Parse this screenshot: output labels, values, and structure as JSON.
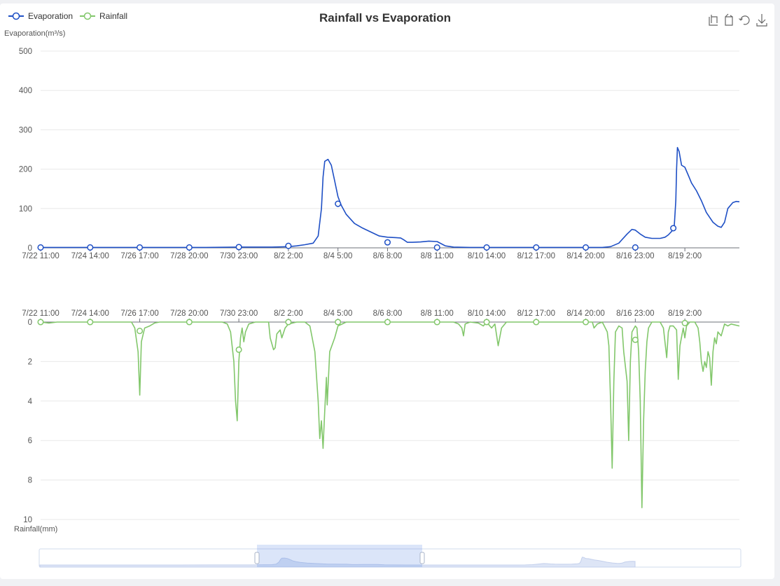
{
  "chart_data": {
    "type": "line",
    "title": "Rainfall vs Evaporation",
    "legend": {
      "placement": "top-left",
      "entries": [
        "Evaporation",
        "Rainfall"
      ]
    },
    "toolbox_icons": [
      "zoom-icon",
      "zoom-reset-icon",
      "restore-icon",
      "download-icon"
    ],
    "colors": {
      "Evaporation": "#1e4fc5",
      "Rainfall": "#82c76b"
    },
    "x_tick_labels": [
      "7/22 11:00",
      "7/24 14:00",
      "7/26 17:00",
      "7/28 20:00",
      "7/30 23:00",
      "8/2 2:00",
      "8/4 5:00",
      "8/6 8:00",
      "8/8 11:00",
      "8/10 14:00",
      "8/12 17:00",
      "8/14 20:00",
      "8/16 23:00",
      "8/19 2:00"
    ],
    "top": {
      "ylabel": "Evaporation(m³/s)",
      "ylim": [
        0,
        500
      ],
      "yticks": [
        0,
        100,
        200,
        300,
        400,
        500
      ],
      "series": [
        {
          "name": "Evaporation",
          "points": [
            [
              0,
              1
            ],
            [
              2,
              1
            ],
            [
              4,
              1
            ],
            [
              6,
              1
            ],
            [
              8,
              1
            ],
            [
              10,
              1
            ],
            [
              12,
              2
            ],
            [
              14,
              2
            ],
            [
              15,
              3
            ],
            [
              15.5,
              5
            ],
            [
              16,
              8
            ],
            [
              16.5,
              12
            ],
            [
              16.8,
              30
            ],
            [
              17,
              100
            ],
            [
              17.1,
              180
            ],
            [
              17.2,
              220
            ],
            [
              17.4,
              225
            ],
            [
              17.6,
              210
            ],
            [
              17.8,
              170
            ],
            [
              18,
              130
            ],
            [
              18.2,
              108
            ],
            [
              18.5,
              85
            ],
            [
              19,
              62
            ],
            [
              19.5,
              50
            ],
            [
              20,
              40
            ],
            [
              20.5,
              30
            ],
            [
              21,
              27
            ],
            [
              21.5,
              26
            ],
            [
              21.8,
              25
            ],
            [
              22,
              20
            ],
            [
              22.2,
              14
            ],
            [
              22.5,
              14
            ],
            [
              23,
              15
            ],
            [
              23.5,
              17
            ],
            [
              24,
              16
            ],
            [
              24.5,
              5
            ],
            [
              25,
              2
            ],
            [
              26,
              1
            ],
            [
              28,
              1
            ],
            [
              30,
              1
            ],
            [
              32,
              1
            ],
            [
              34,
              1
            ],
            [
              34.5,
              3
            ],
            [
              35,
              12
            ],
            [
              35.5,
              35
            ],
            [
              35.8,
              47
            ],
            [
              36,
              45
            ],
            [
              36.3,
              35
            ],
            [
              36.6,
              27
            ],
            [
              37,
              24
            ],
            [
              37.5,
              24
            ],
            [
              37.8,
              27
            ],
            [
              38,
              33
            ],
            [
              38.2,
              42
            ],
            [
              38.35,
              50
            ],
            [
              38.45,
              120
            ],
            [
              38.5,
              200
            ],
            [
              38.55,
              255
            ],
            [
              38.65,
              245
            ],
            [
              38.8,
              210
            ],
            [
              39,
              205
            ],
            [
              39.2,
              185
            ],
            [
              39.4,
              165
            ],
            [
              39.7,
              145
            ],
            [
              40,
              120
            ],
            [
              40.3,
              90
            ],
            [
              40.7,
              65
            ],
            [
              41,
              55
            ],
            [
              41.2,
              52
            ],
            [
              41.4,
              65
            ],
            [
              41.6,
              100
            ],
            [
              41.9,
              115
            ],
            [
              42.1,
              118
            ],
            [
              42.3,
              117
            ]
          ],
          "markers": [
            [
              0,
              1
            ],
            [
              3,
              1
            ],
            [
              6,
              1
            ],
            [
              9,
              1
            ],
            [
              12,
              2
            ],
            [
              15,
              5
            ],
            [
              18,
              112
            ],
            [
              21,
              14
            ],
            [
              24,
              1
            ],
            [
              27,
              1
            ],
            [
              30,
              1
            ],
            [
              33,
              1
            ],
            [
              36,
              1
            ],
            [
              38.3,
              50
            ]
          ]
        }
      ]
    },
    "bottom": {
      "ylabel": "Rainfall(mm)",
      "ylim": [
        0,
        10
      ],
      "inverted": true,
      "yticks": [
        0,
        2,
        4,
        6,
        8,
        10
      ],
      "series": [
        {
          "name": "Rainfall",
          "points": [
            [
              0,
              0
            ],
            [
              0.5,
              0.05
            ],
            [
              1,
              0
            ],
            [
              2,
              0
            ],
            [
              3,
              0
            ],
            [
              4,
              0
            ],
            [
              5,
              0
            ],
            [
              5.5,
              0
            ],
            [
              5.7,
              0.3
            ],
            [
              5.9,
              1.5
            ],
            [
              6.0,
              3.7
            ],
            [
              6.1,
              1.0
            ],
            [
              6.3,
              0.3
            ],
            [
              6.6,
              0.2
            ],
            [
              6.9,
              0.05
            ],
            [
              7.2,
              0
            ],
            [
              8,
              0
            ],
            [
              9,
              0
            ],
            [
              10,
              0
            ],
            [
              11,
              0
            ],
            [
              11.3,
              0.1
            ],
            [
              11.5,
              0.5
            ],
            [
              11.7,
              2.0
            ],
            [
              11.8,
              4.0
            ],
            [
              11.9,
              5.0
            ],
            [
              12.0,
              2.0
            ],
            [
              12.1,
              0.8
            ],
            [
              12.2,
              0.3
            ],
            [
              12.3,
              1.0
            ],
            [
              12.4,
              0.5
            ],
            [
              12.6,
              0.1
            ],
            [
              13,
              0
            ],
            [
              13.8,
              0
            ],
            [
              13.9,
              0.8
            ],
            [
              14.1,
              1.4
            ],
            [
              14.2,
              1.3
            ],
            [
              14.3,
              0.6
            ],
            [
              14.5,
              0.4
            ],
            [
              14.6,
              0.8
            ],
            [
              14.8,
              0.3
            ],
            [
              15,
              0.1
            ],
            [
              15.5,
              0
            ],
            [
              16,
              0
            ],
            [
              16.3,
              0.2
            ],
            [
              16.6,
              1.5
            ],
            [
              16.8,
              4.0
            ],
            [
              16.9,
              5.9
            ],
            [
              17.0,
              5.0
            ],
            [
              17.1,
              6.4
            ],
            [
              17.2,
              4.5
            ],
            [
              17.3,
              2.8
            ],
            [
              17.35,
              4.2
            ],
            [
              17.5,
              1.5
            ],
            [
              17.8,
              0.8
            ],
            [
              18,
              0.2
            ],
            [
              18.5,
              0
            ],
            [
              19,
              0
            ],
            [
              20,
              0
            ],
            [
              21,
              0
            ],
            [
              22,
              0
            ],
            [
              23,
              0
            ],
            [
              24,
              0
            ],
            [
              25,
              0
            ],
            [
              25.3,
              0.1
            ],
            [
              25.5,
              0.3
            ],
            [
              25.6,
              0.7
            ],
            [
              25.7,
              0.1
            ],
            [
              26,
              0
            ],
            [
              26.5,
              0.05
            ],
            [
              26.8,
              0.2
            ],
            [
              27,
              0
            ],
            [
              27.3,
              0.3
            ],
            [
              27.5,
              0.1
            ],
            [
              27.7,
              1.2
            ],
            [
              27.9,
              0.3
            ],
            [
              28.2,
              0
            ],
            [
              29,
              0
            ],
            [
              30,
              0
            ],
            [
              31,
              0
            ],
            [
              32,
              0
            ],
            [
              33,
              0
            ],
            [
              33.4,
              0
            ],
            [
              33.5,
              0.3
            ],
            [
              33.7,
              0.1
            ],
            [
              34,
              0
            ],
            [
              34.3,
              0.5
            ],
            [
              34.4,
              1.2
            ],
            [
              34.5,
              4.0
            ],
            [
              34.6,
              7.4
            ],
            [
              34.7,
              3.0
            ],
            [
              34.8,
              0.5
            ],
            [
              35,
              0.2
            ],
            [
              35.2,
              0.3
            ],
            [
              35.3,
              1.5
            ],
            [
              35.5,
              3.0
            ],
            [
              35.6,
              6.0
            ],
            [
              35.7,
              2.0
            ],
            [
              35.8,
              0.5
            ],
            [
              36,
              0.2
            ],
            [
              36.1,
              0.3
            ],
            [
              36.2,
              1.5
            ],
            [
              36.3,
              4.0
            ],
            [
              36.4,
              9.4
            ],
            [
              36.5,
              5.0
            ],
            [
              36.6,
              2.5
            ],
            [
              36.7,
              1.0
            ],
            [
              36.8,
              0.3
            ],
            [
              37,
              0
            ],
            [
              37.5,
              0
            ],
            [
              37.7,
              0.3
            ],
            [
              37.9,
              1.8
            ],
            [
              38.0,
              0.5
            ],
            [
              38.1,
              0.2
            ],
            [
              38.3,
              0.2
            ],
            [
              38.5,
              0.4
            ],
            [
              38.6,
              2.9
            ],
            [
              38.7,
              1.2
            ],
            [
              38.9,
              0.3
            ],
            [
              39.0,
              0.8
            ],
            [
              39.1,
              0.2
            ],
            [
              39.3,
              0
            ],
            [
              39.6,
              0
            ],
            [
              39.8,
              0.3
            ],
            [
              39.9,
              1.0
            ],
            [
              40.0,
              2.0
            ],
            [
              40.1,
              2.5
            ],
            [
              40.2,
              2.0
            ],
            [
              40.3,
              2.3
            ],
            [
              40.4,
              1.5
            ],
            [
              40.5,
              1.8
            ],
            [
              40.6,
              3.2
            ],
            [
              40.7,
              1.5
            ],
            [
              40.8,
              0.8
            ],
            [
              40.9,
              1.1
            ],
            [
              41.0,
              0.5
            ],
            [
              41.2,
              0.7
            ],
            [
              41.4,
              0.1
            ],
            [
              41.6,
              0.2
            ],
            [
              41.8,
              0.1
            ],
            [
              42.3,
              0.2
            ]
          ],
          "markers": [
            [
              0,
              0
            ],
            [
              3,
              0
            ],
            [
              6,
              0.45
            ],
            [
              9,
              0
            ],
            [
              12,
              1.4
            ],
            [
              15,
              0
            ],
            [
              18,
              0
            ],
            [
              21,
              0
            ],
            [
              24,
              0
            ],
            [
              27,
              0
            ],
            [
              30,
              0
            ],
            [
              33,
              0
            ],
            [
              36,
              0.9
            ],
            [
              39,
              0.05
            ]
          ]
        }
      ]
    },
    "x_range": [
      0,
      42.3
    ],
    "tick_positions": [
      0,
      3,
      6,
      9,
      12,
      15,
      18,
      21,
      24,
      27,
      30,
      33,
      36,
      39
    ],
    "data_zoom": {
      "start_fraction": 0.31,
      "end_fraction": 0.546
    }
  }
}
